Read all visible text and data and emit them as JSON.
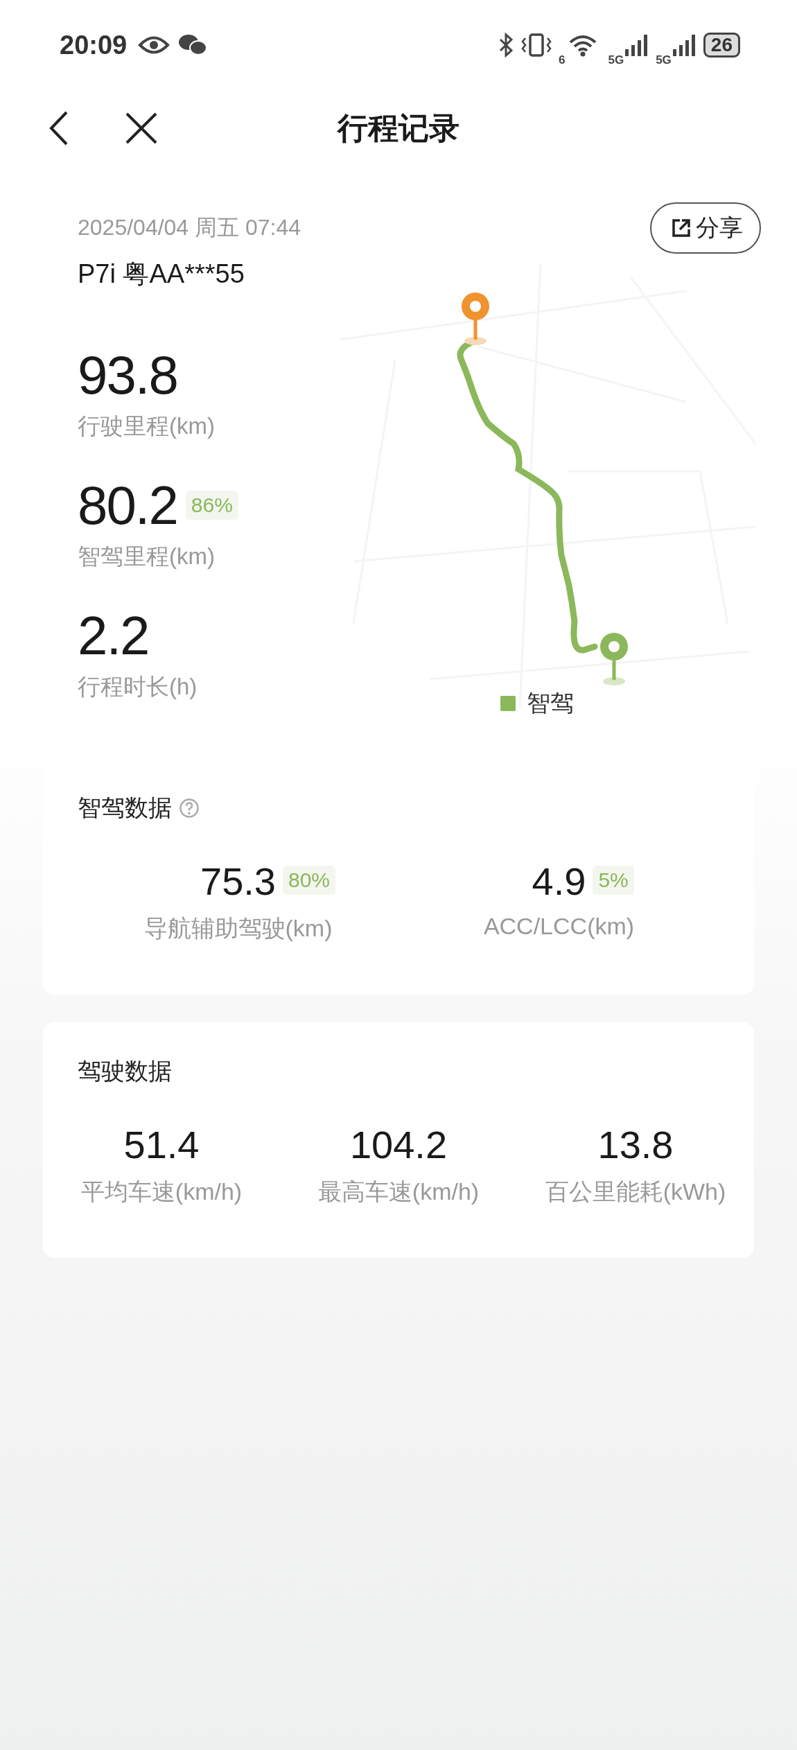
{
  "status_bar": {
    "time": "20:09",
    "wifi_label": "6",
    "network_labels": [
      "5G",
      "5G"
    ],
    "battery": "26"
  },
  "header": {
    "title": "行程记录"
  },
  "trip": {
    "datetime": "2025/04/04 周五 07:44",
    "vehicle": "P7i 粤AA***55",
    "share_label": "分享",
    "stats": [
      {
        "value": "93.8",
        "label": "行驶里程(km)"
      },
      {
        "value": "80.2",
        "percent": "86%",
        "label": "智驾里程(km)"
      },
      {
        "value": "2.2",
        "label": "行程时长(h)"
      }
    ],
    "map_legend": [
      {
        "label": "智驾",
        "color": "#8bb85a"
      }
    ]
  },
  "smart_driving": {
    "title": "智驾数据",
    "metrics": [
      {
        "value": "75.3",
        "percent": "80%",
        "label": "导航辅助驾驶(km)"
      },
      {
        "value": "4.9",
        "percent": "5%",
        "label": "ACC/LCC(km)"
      }
    ]
  },
  "driving": {
    "title": "驾驶数据",
    "metrics": [
      {
        "value": "51.4",
        "label": "平均车速(km/h)"
      },
      {
        "value": "104.2",
        "label": "最高车速(km/h)"
      },
      {
        "value": "13.8",
        "label": "百公里能耗(kWh)"
      }
    ]
  }
}
